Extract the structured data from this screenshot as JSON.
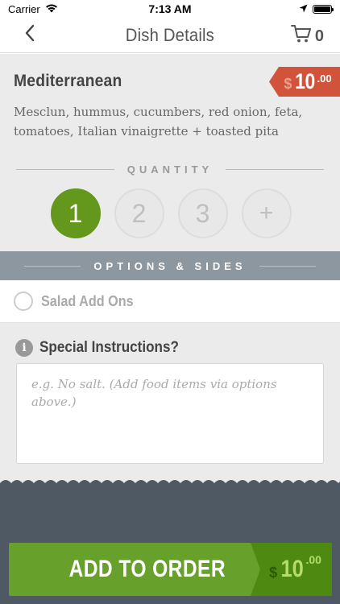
{
  "status_bar": {
    "carrier": "Carrier",
    "time": "7:13 AM"
  },
  "nav": {
    "title": "Dish Details",
    "cart_count": "0"
  },
  "dish": {
    "name": "Mediterranean",
    "price_currency": "$",
    "price_dollars": "10",
    "price_cents": ".00",
    "description": "Mesclun, hummus, cucumbers, red onion, feta, tomatoes, Italian vinaigrette + toasted pita"
  },
  "quantity": {
    "label": "QUANTITY",
    "options": [
      "1",
      "2",
      "3",
      "+"
    ],
    "selected": "1"
  },
  "options_sides": {
    "label": "OPTIONS & SIDES",
    "items": [
      {
        "label": "Salad Add Ons",
        "selected": false
      }
    ]
  },
  "special_instructions": {
    "title": "Special Instructions?",
    "placeholder": "e.g. No salt. (Add food items via options above.)",
    "value": ""
  },
  "add_button": {
    "label": "ADD TO ORDER",
    "price_currency": "$",
    "price_dollars": "10",
    "price_cents": ".00"
  },
  "colors": {
    "accent_green": "#67a02b",
    "price_red": "#d1533a",
    "options_bar": "#8c97a0",
    "footer_dark": "#4f5964"
  }
}
